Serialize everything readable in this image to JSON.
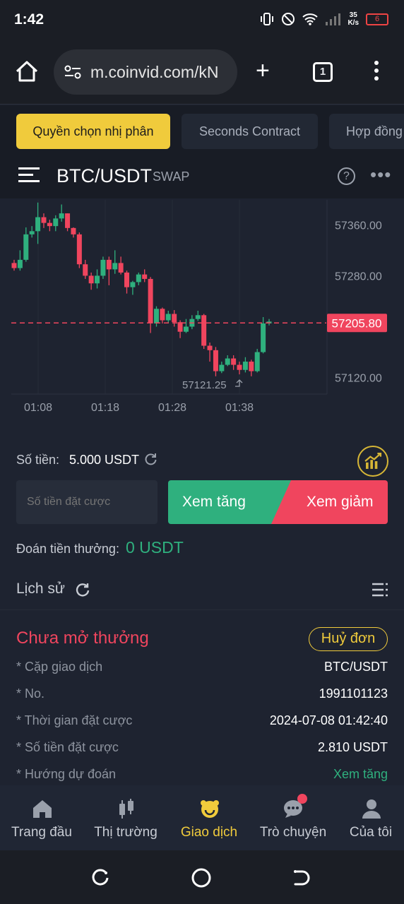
{
  "status": {
    "time": "1:42",
    "net_speed_top": "35",
    "net_speed_bottom": "K/s",
    "battery": "6"
  },
  "browser": {
    "url": "m.coinvid.com/kN",
    "tab_count": "1"
  },
  "tabs": [
    {
      "label": "Quyền chọn nhị phân",
      "active": true
    },
    {
      "label": "Seconds Contract",
      "active": false
    },
    {
      "label": "Hợp đồng",
      "active": false
    }
  ],
  "symbol": {
    "pair": "BTC/USDT",
    "tag": "SWAP",
    "help": "?"
  },
  "chart_data": {
    "type": "candlestick",
    "x_ticks": [
      "01:08",
      "01:18",
      "01:28",
      "01:38"
    ],
    "y_ticks": [
      "57360.00",
      "57280.00",
      "57120.00"
    ],
    "ylim": [
      57094,
      57397
    ],
    "current_price": "57205.80",
    "low_label": "57121.25",
    "colors": {
      "up": "#2fb07e",
      "down": "#f0455e",
      "grid": "#2c3240"
    },
    "candles": [
      [
        57300,
        57292,
        57305,
        57288
      ],
      [
        57292,
        57305,
        57320,
        57288
      ],
      [
        57305,
        57345,
        57356,
        57302
      ],
      [
        57345,
        57350,
        57358,
        57340
      ],
      [
        57350,
        57372,
        57395,
        57330
      ],
      [
        57372,
        57363,
        57378,
        57355
      ],
      [
        57363,
        57358,
        57368,
        57350
      ],
      [
        57358,
        57370,
        57375,
        57350
      ],
      [
        57370,
        57378,
        57392,
        57365
      ],
      [
        57378,
        57355,
        57378,
        57350
      ],
      [
        57355,
        57345,
        57356,
        57340
      ],
      [
        57345,
        57298,
        57348,
        57292
      ],
      [
        57298,
        57280,
        57305,
        57275
      ],
      [
        57280,
        57268,
        57285,
        57258
      ],
      [
        57268,
        57280,
        57290,
        57260
      ],
      [
        57280,
        57305,
        57310,
        57275
      ],
      [
        57305,
        57290,
        57310,
        57265
      ],
      [
        57290,
        57300,
        57320,
        57283
      ],
      [
        57300,
        57285,
        57310,
        57282
      ],
      [
        57285,
        57262,
        57288,
        57252
      ],
      [
        57262,
        57270,
        57272,
        57250
      ],
      [
        57270,
        57282,
        57285,
        57265
      ],
      [
        57282,
        57275,
        57290,
        57270
      ],
      [
        57275,
        57205,
        57278,
        57190
      ],
      [
        57205,
        57228,
        57232,
        57200
      ],
      [
        57228,
        57210,
        57230,
        57205
      ],
      [
        57210,
        57220,
        57225,
        57206
      ],
      [
        57220,
        57207,
        57226,
        57200
      ],
      [
        57207,
        57192,
        57210,
        57182
      ],
      [
        57192,
        57200,
        57212,
        57190
      ],
      [
        57200,
        57212,
        57218,
        57196
      ],
      [
        57212,
        57218,
        57225,
        57209
      ],
      [
        57218,
        57170,
        57220,
        57165
      ],
      [
        57170,
        57163,
        57175,
        57145
      ],
      [
        57163,
        57130,
        57168,
        57122
      ],
      [
        57130,
        57140,
        57145,
        57127
      ],
      [
        57140,
        57150,
        57155,
        57138
      ],
      [
        57150,
        57140,
        57155,
        57132
      ],
      [
        57140,
        57132,
        57145,
        57125
      ],
      [
        57132,
        57145,
        57152,
        57128
      ],
      [
        57145,
        57130,
        57148,
        57122
      ],
      [
        57130,
        57160,
        57165,
        57128
      ],
      [
        57160,
        57205,
        57215,
        57158
      ],
      [
        57205,
        57208,
        57212,
        57202
      ]
    ]
  },
  "trade": {
    "amount_label": "Số tiền:",
    "amount_value": "5.000 USDT",
    "input_placeholder": "Số tiền đặt cược",
    "up_label": "Xem tăng",
    "down_label": "Xem giảm",
    "reward_label": "Đoán tiền thưởng:",
    "reward_value": "0 USDT"
  },
  "history": {
    "label": "Lịch sử"
  },
  "order": {
    "status": "Chưa mở thưởng",
    "cancel_label": "Huỷ đơn",
    "rows": [
      {
        "k": "* Cặp giao dịch",
        "v": "BTC/USDT"
      },
      {
        "k": "* No.",
        "v": "1991101123"
      },
      {
        "k": "* Thời gian đặt cược",
        "v": "2024-07-08 01:42:40"
      },
      {
        "k": "* Số tiền đặt cược",
        "v": "2.810 USDT"
      },
      {
        "k": "* Hướng dự đoán",
        "v": "Xem tăng"
      }
    ]
  },
  "nav": [
    {
      "label": "Trang đầu",
      "icon": "home-icon",
      "active": false
    },
    {
      "label": "Thị trường",
      "icon": "market-icon",
      "active": false
    },
    {
      "label": "Giao dịch",
      "icon": "trade-icon",
      "active": true
    },
    {
      "label": "Trò chuyện",
      "icon": "chat-icon",
      "active": false
    },
    {
      "label": "Của tôi",
      "icon": "user-icon",
      "active": false
    }
  ]
}
